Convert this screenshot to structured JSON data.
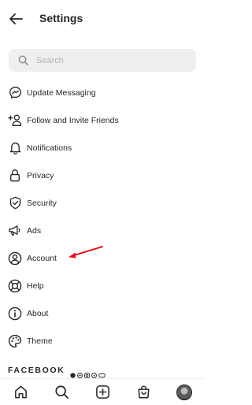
{
  "status_bar": {
    "left": "",
    "center": "",
    "right": ""
  },
  "header": {
    "title": "Settings"
  },
  "search": {
    "placeholder": "Search"
  },
  "menu": {
    "items": [
      {
        "label": "Update Messaging",
        "icon": "messenger-icon"
      },
      {
        "label": "Follow and Invite Friends",
        "icon": "add-person-icon"
      },
      {
        "label": "Notifications",
        "icon": "bell-icon"
      },
      {
        "label": "Privacy",
        "icon": "lock-icon"
      },
      {
        "label": "Security",
        "icon": "shield-icon"
      },
      {
        "label": "Ads",
        "icon": "megaphone-icon"
      },
      {
        "label": "Account",
        "icon": "account-circle-icon"
      },
      {
        "label": "Help",
        "icon": "lifebuoy-icon"
      },
      {
        "label": "About",
        "icon": "info-icon"
      },
      {
        "label": "Theme",
        "icon": "palette-icon"
      }
    ]
  },
  "footer": {
    "brand": "FACEBOOK"
  },
  "bottom_nav": [
    "home-icon",
    "search-icon",
    "new-post-icon",
    "shop-icon",
    "profile-avatar"
  ],
  "colors": {
    "text": "#262626",
    "search_bg": "#efefef",
    "placeholder": "#b5b5b5",
    "annotation_arrow": "#e0141e"
  }
}
